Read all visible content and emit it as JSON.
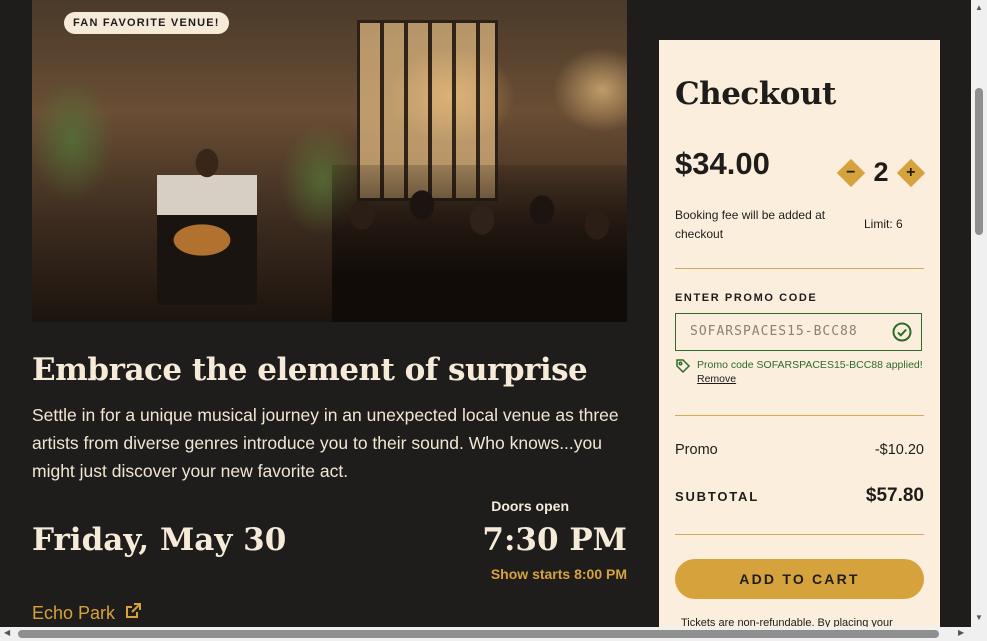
{
  "hero": {
    "badge": "FAN FAVORITE VENUE!"
  },
  "event": {
    "headline": "Embrace the element of surprise",
    "description": "Settle in for a unique musical journey in an unexpected local venue as three artists from diverse genres introduce you to their sound. Who knows...you might just discover your new favorite act.",
    "date": "Friday, May 30",
    "doors_label": "Doors open",
    "doors_time": "7:30 PM",
    "show_starts": "Show starts 8:00 PM",
    "venue": "Echo Park"
  },
  "checkout": {
    "title": "Checkout",
    "price": "$34.00",
    "quantity": "2",
    "minus_label": "−",
    "plus_label": "+",
    "fee_note": "Booking fee will be added at checkout",
    "limit": "Limit: 6",
    "promo_label": "ENTER PROMO CODE",
    "promo_value": "SOFARSPACES15-BCC88",
    "promo_applied": "Promo code SOFARSPACES15-BCC88 applied!",
    "remove_label": "Remove",
    "promo_row_label": "Promo",
    "promo_row_value": "-$10.20",
    "subtotal_label": "SUBTOTAL",
    "subtotal_value": "$57.80",
    "cart_button": "ADD TO CART",
    "terms": "Tickets are non-refundable. By placing your"
  },
  "colors": {
    "background": "#1e1d1c",
    "cream": "#fbeedc",
    "gold": "#d6a23c",
    "success_green": "#2f6b2a"
  },
  "icons": {
    "venue_link": "external-link-icon",
    "promo_valid": "check-circle-icon",
    "promo_tag": "tag-icon"
  }
}
